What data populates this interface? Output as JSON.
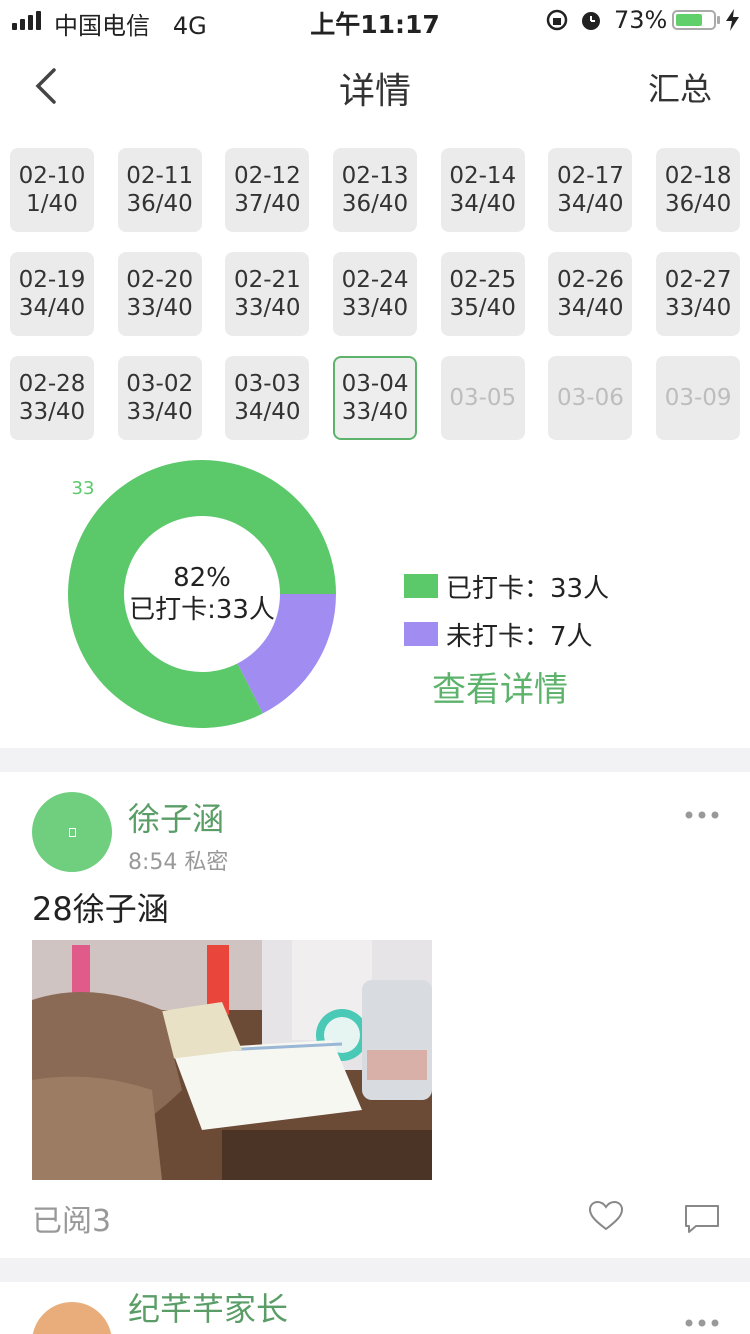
{
  "status_bar": {
    "carrier": "中国电信",
    "network": "4G",
    "time": "上午11:17",
    "battery_pct": "73%",
    "battery_level": 0.73
  },
  "nav": {
    "back_icon": "chevron-left-icon",
    "title": "详情",
    "right_action": "汇总"
  },
  "dates": [
    {
      "date": "02-10",
      "count": "1/40",
      "state": "normal"
    },
    {
      "date": "02-11",
      "count": "36/40",
      "state": "normal"
    },
    {
      "date": "02-12",
      "count": "37/40",
      "state": "normal"
    },
    {
      "date": "02-13",
      "count": "36/40",
      "state": "normal"
    },
    {
      "date": "02-14",
      "count": "34/40",
      "state": "normal"
    },
    {
      "date": "02-17",
      "count": "34/40",
      "state": "normal"
    },
    {
      "date": "02-18",
      "count": "36/40",
      "state": "normal"
    },
    {
      "date": "02-19",
      "count": "34/40",
      "state": "normal"
    },
    {
      "date": "02-20",
      "count": "33/40",
      "state": "normal"
    },
    {
      "date": "02-21",
      "count": "33/40",
      "state": "normal"
    },
    {
      "date": "02-24",
      "count": "33/40",
      "state": "normal"
    },
    {
      "date": "02-25",
      "count": "35/40",
      "state": "normal"
    },
    {
      "date": "02-26",
      "count": "34/40",
      "state": "normal"
    },
    {
      "date": "02-27",
      "count": "33/40",
      "state": "normal"
    },
    {
      "date": "02-28",
      "count": "33/40",
      "state": "normal"
    },
    {
      "date": "03-02",
      "count": "33/40",
      "state": "normal"
    },
    {
      "date": "03-03",
      "count": "34/40",
      "state": "normal"
    },
    {
      "date": "03-04",
      "count": "33/40",
      "state": "selected"
    },
    {
      "date": "03-05",
      "count": "",
      "state": "disabled"
    },
    {
      "date": "03-06",
      "count": "",
      "state": "disabled"
    },
    {
      "date": "03-09",
      "count": "",
      "state": "disabled"
    }
  ],
  "chart_data": {
    "type": "pie",
    "slice_label": "33",
    "center_percent": "82%",
    "center_label": "已打卡:33人",
    "slices": [
      {
        "name": "已打卡",
        "value": 33,
        "color": "#5bc86a"
      },
      {
        "name": "未打卡",
        "value": 7,
        "color": "#a18cf2"
      }
    ],
    "legend": [
      {
        "label": "已打卡：",
        "value": "33人",
        "color": "#5bc86a"
      },
      {
        "label": "未打卡：",
        "value": "7人",
        "color": "#a18cf2"
      }
    ]
  },
  "view_details": "查看详情",
  "posts": [
    {
      "name": "徐子涵",
      "time": "8:54",
      "privacy": "私密",
      "text": "28徐子涵",
      "read": "已阅3",
      "avatar_color": "#6fcf7f"
    },
    {
      "name": "纪芊芊家长",
      "avatar_color": "#e8ad7a"
    }
  ]
}
